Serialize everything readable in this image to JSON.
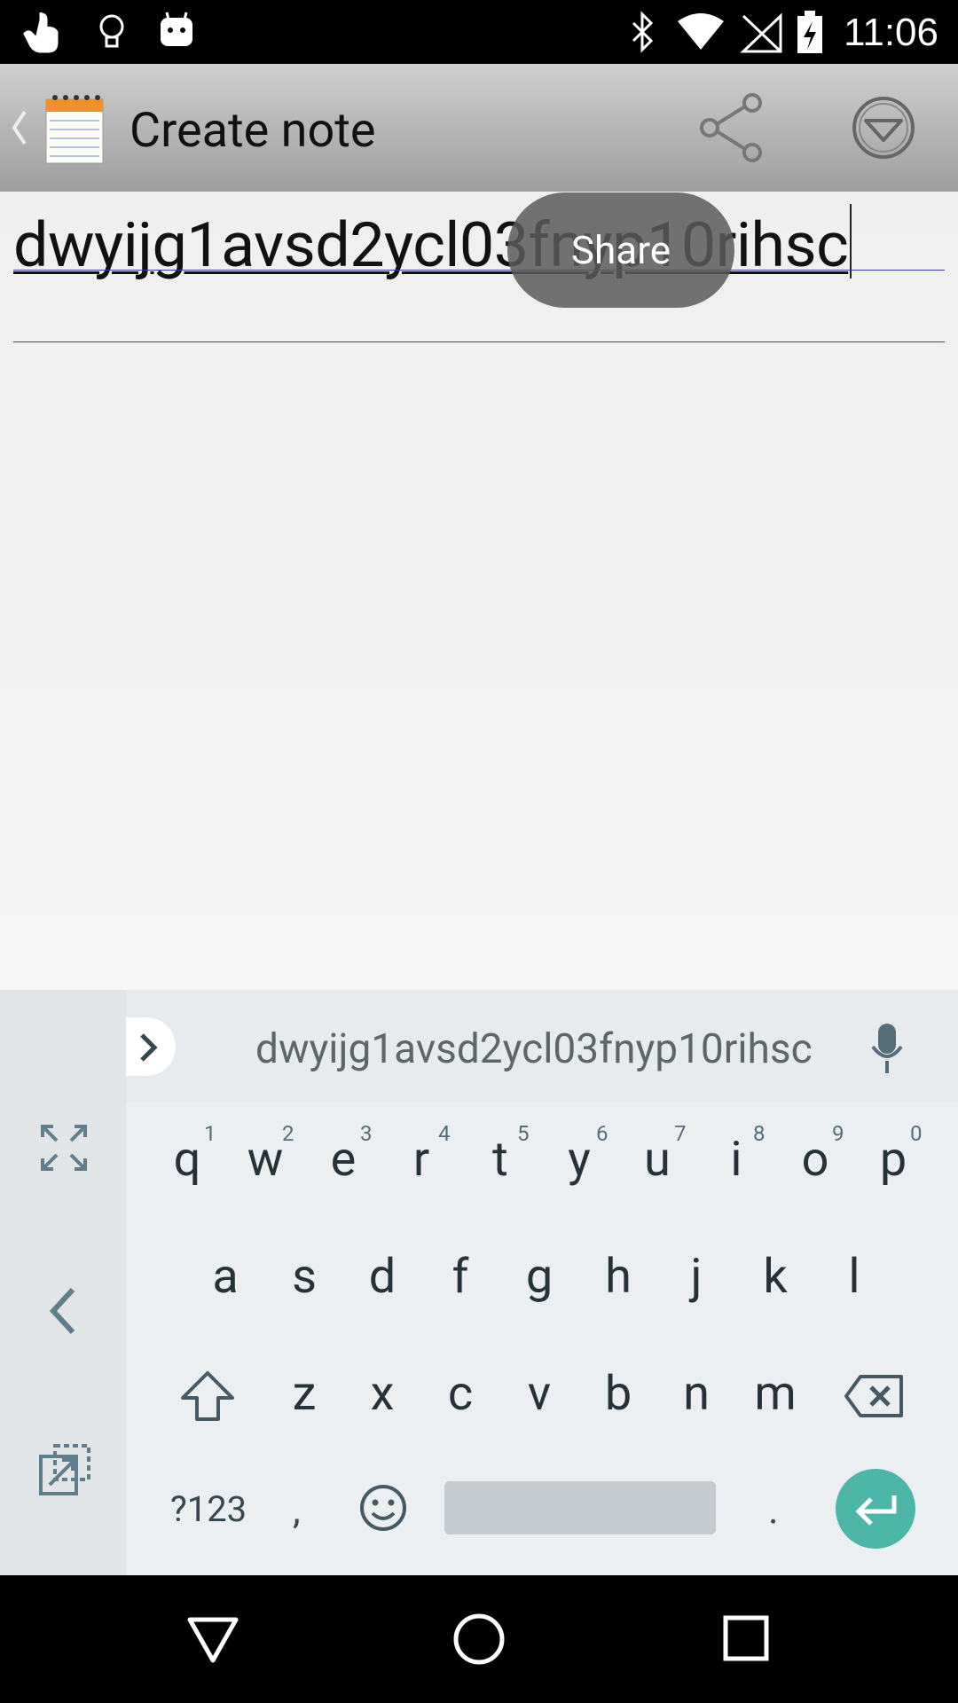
{
  "status_bar": {
    "time": "11:06"
  },
  "action_bar": {
    "title": "Create note"
  },
  "note": {
    "text": "dwyijg1avsd2ycl03fnyp10rihsc"
  },
  "toast": {
    "label": "Share"
  },
  "keyboard": {
    "suggestion": "dwyijg1avsd2ycl03fnyp10rihsc",
    "row1": [
      "q",
      "w",
      "e",
      "r",
      "t",
      "y",
      "u",
      "i",
      "o",
      "p"
    ],
    "row1_nums": [
      "1",
      "2",
      "3",
      "4",
      "5",
      "6",
      "7",
      "8",
      "9",
      "0"
    ],
    "row2": [
      "a",
      "s",
      "d",
      "f",
      "g",
      "h",
      "j",
      "k",
      "l"
    ],
    "row3": [
      "z",
      "x",
      "c",
      "v",
      "b",
      "n",
      "m"
    ],
    "symbols_label": "?123",
    "comma": ",",
    "period": "."
  },
  "colors": {
    "accent": "#4cb6a9",
    "action_bar": "#b4b4b4"
  }
}
